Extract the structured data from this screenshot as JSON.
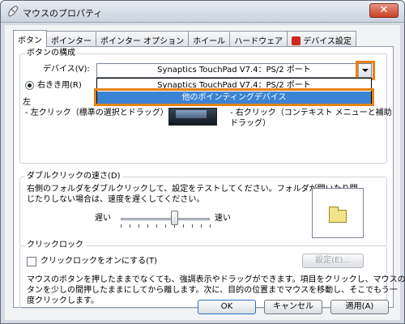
{
  "window": {
    "title": "マウスのプロパティ",
    "close_label": "✕"
  },
  "tabs": [
    {
      "label": "ボタン"
    },
    {
      "label": "ポインター"
    },
    {
      "label": "ポインター オプション"
    },
    {
      "label": "ホイール"
    },
    {
      "label": "ハードウェア"
    },
    {
      "label": "デバイス設定"
    }
  ],
  "button_config": {
    "group_label": "ボタンの構成",
    "device_label": "デバイス(V):",
    "device_value": "Synaptics TouchPad V7.4：PS/2 ポート",
    "dropdown_options": [
      "Synaptics TouchPad V7.4：PS/2 ポート",
      "他のポインティングデバイス"
    ],
    "selected_option_index": 1,
    "right_hand_label": "右きき用(R)",
    "left_label": "左",
    "left_click_desc": "- 左クリック（標準の選択とドラッグ）",
    "right_desc_line1": "- 右クリック（コンテキスト メニューと補助",
    "right_desc_line2": "ドラッグ）"
  },
  "double_click": {
    "group_label": "ダブルクリックの速さ(D)",
    "desc_line1": "右側のフォルダをダブルクリックして、設定をテストしてください。フォルダが開いたり閉",
    "desc_line2": "じたりしない場合は、速度を遅くしてください。",
    "slow_label": "遅い",
    "fast_label": "速い",
    "speed_fraction": 0.6
  },
  "click_lock": {
    "group_label": "クリックロック",
    "checkbox_label": "クリックロックをオンにする(T)",
    "settings_button": "設定(E)...",
    "desc_line1": "マウスのボタンを押したままでなくても、強調表示やドラッグができます。項目をクリックし、マウスのボ",
    "desc_line2": "タンを少しの間押したままにしてから離します。次に、目的の位置までマウスを移動し、そこでもう一",
    "desc_line3": "度クリックします。"
  },
  "footer": {
    "ok": "OK",
    "cancel": "キャンセル",
    "apply": "適用(A)"
  },
  "colors": {
    "highlight": "#e88213",
    "selection": "#3b84d4"
  }
}
